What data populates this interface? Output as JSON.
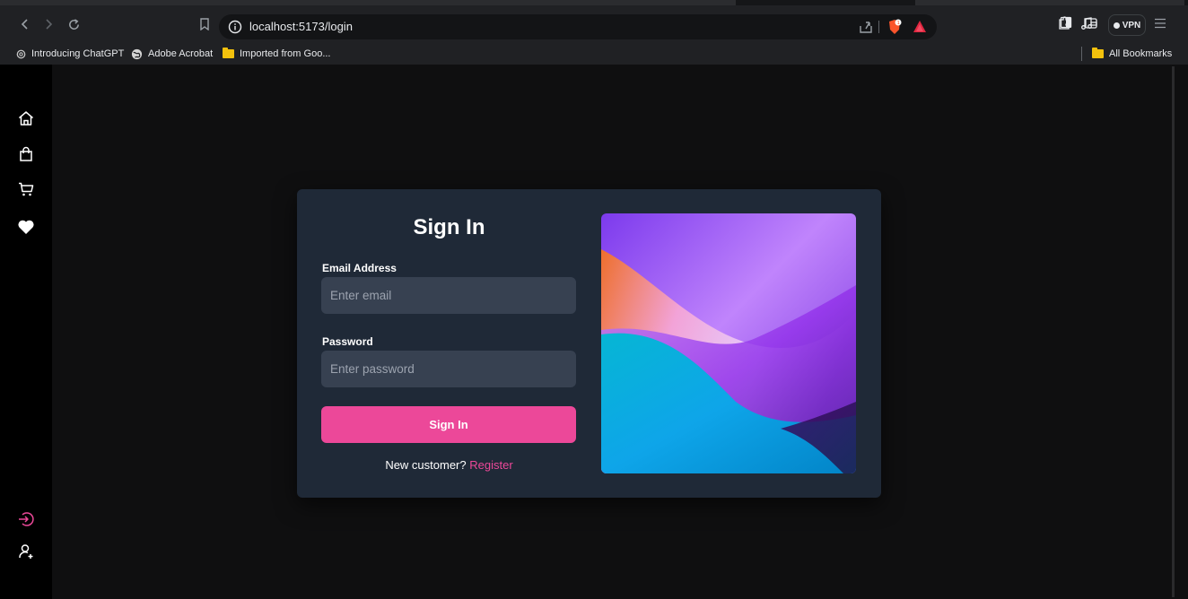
{
  "browser": {
    "url": "localhost:5173/login",
    "vpn_label": "VPN",
    "bookmarks": [
      {
        "label": "Introducing ChatGPT",
        "icon": "openai-icon"
      },
      {
        "label": "Adobe Acrobat",
        "icon": "globe-icon"
      },
      {
        "label": "Imported from Goo...",
        "icon": "folder-icon"
      }
    ],
    "all_bookmarks": "All Bookmarks"
  },
  "sidebar": {
    "top_items": [
      "home-icon",
      "shopping-bag-icon",
      "cart-icon",
      "heart-icon"
    ],
    "bottom_items": [
      "login-icon",
      "register-user-icon"
    ]
  },
  "login": {
    "title": "Sign In",
    "email_label": "Email Address",
    "email_placeholder": "Enter email",
    "email_value": "",
    "password_label": "Password",
    "password_placeholder": "Enter password",
    "password_value": "",
    "submit_label": "Sign In",
    "new_customer_text": "New customer?",
    "register_link": "Register"
  },
  "colors": {
    "accent": "#ec4899",
    "card": "#1f2937",
    "input": "#374151",
    "sidebar": "#000000",
    "page": "#0f0f10"
  }
}
